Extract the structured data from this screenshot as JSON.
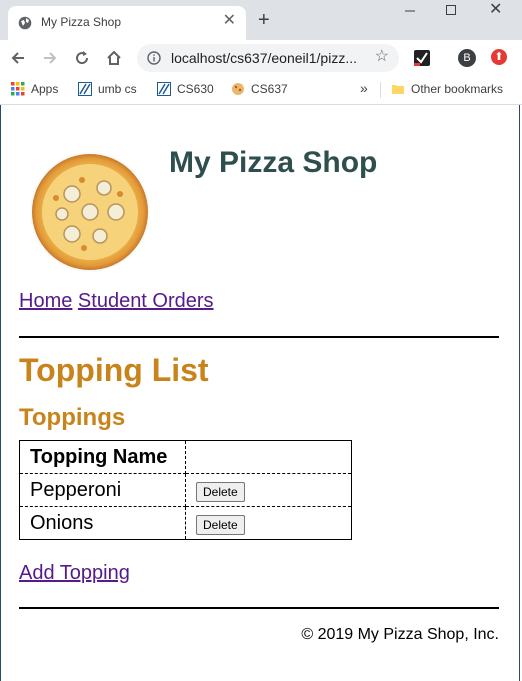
{
  "browser": {
    "tab_title": "My Pizza Shop",
    "url": "localhost/cs637/eoneil1/pizz...",
    "new_tab": "+",
    "avatar_letter": "B",
    "bookmarks": [
      "Apps",
      "umb cs",
      "CS630",
      "CS637"
    ],
    "bookmarks_overflow": "»",
    "other_bookmarks": "Other bookmarks"
  },
  "header": {
    "title": "My Pizza Shop",
    "nav": [
      "Home",
      "Student Orders"
    ]
  },
  "main": {
    "heading": "Topping List",
    "subheading": "Toppings",
    "table": {
      "column_header": "Topping Name",
      "rows": [
        {
          "name": "Pepperoni",
          "action": "Delete"
        },
        {
          "name": "Onions",
          "action": "Delete"
        }
      ]
    },
    "add_link": "Add Topping"
  },
  "footer": {
    "text": "© 2019 My Pizza Shop, Inc."
  },
  "colors": {
    "title": "#2f4f4f",
    "heading": "#c8841a",
    "link_visited": "#551a8b"
  }
}
